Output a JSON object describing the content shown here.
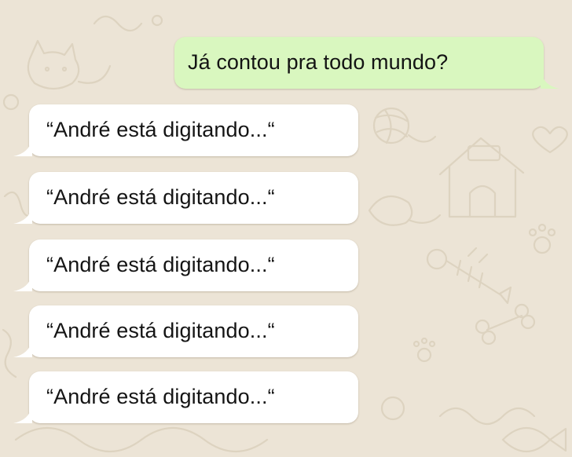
{
  "conversation": {
    "outgoing": [
      {
        "text": "Já contou pra todo mundo?"
      }
    ],
    "incoming": [
      {
        "text": "“André está digitando...“"
      },
      {
        "text": "“André está digitando...“"
      },
      {
        "text": "“André está digitando...“"
      },
      {
        "text": "“André está digitando...“"
      },
      {
        "text": "“André está digitando...“"
      }
    ]
  },
  "colors": {
    "background": "#ece4d6",
    "wallpaper_doodle": "#ddd3c0",
    "outgoing_bubble": "#d9f7bf",
    "incoming_bubble": "#ffffff",
    "text": "#141414"
  },
  "icons": [
    "cat-doodle",
    "yarn-ball-doodle",
    "doghouse-doodle",
    "fish-bone-doodle",
    "bone-doodle",
    "paw-print-doodle",
    "heart-doodle"
  ]
}
